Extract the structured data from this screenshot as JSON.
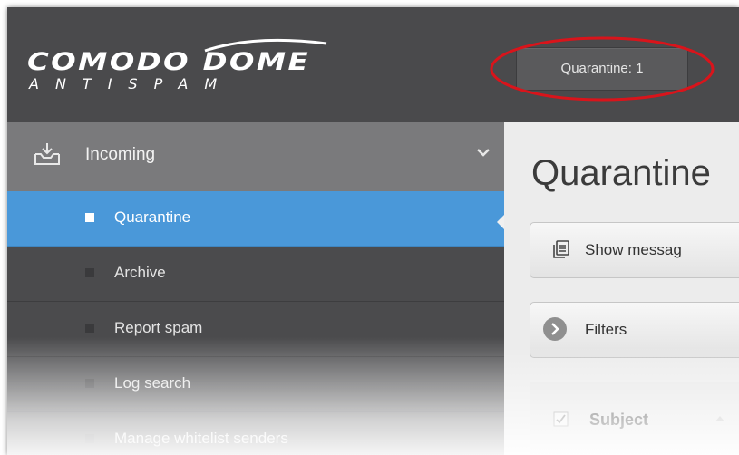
{
  "header": {
    "logo_main": "COMODO DOME",
    "logo_sub": "ANTISPAM",
    "quarantine_badge": "Quarantine: 1"
  },
  "sidebar": {
    "section": {
      "label": "Incoming",
      "icon": "inbox-download-icon"
    },
    "items": [
      {
        "label": "Quarantine",
        "active": true
      },
      {
        "label": "Archive",
        "active": false
      },
      {
        "label": "Report spam",
        "active": false
      },
      {
        "label": "Log search",
        "active": false
      },
      {
        "label": "Manage whitelist senders",
        "active": false
      }
    ]
  },
  "main": {
    "title": "Quarantine",
    "show_messages_label": "Show messag",
    "filters_label": "Filters",
    "table": {
      "subject_header": "Subject"
    }
  },
  "colors": {
    "header_bg": "#4a4a4c",
    "sidebar_bg": "#4b4b4d",
    "section_bg": "#7a7a7c",
    "active_item_bg": "#4a98d9",
    "highlight_ellipse": "#d9141b"
  }
}
